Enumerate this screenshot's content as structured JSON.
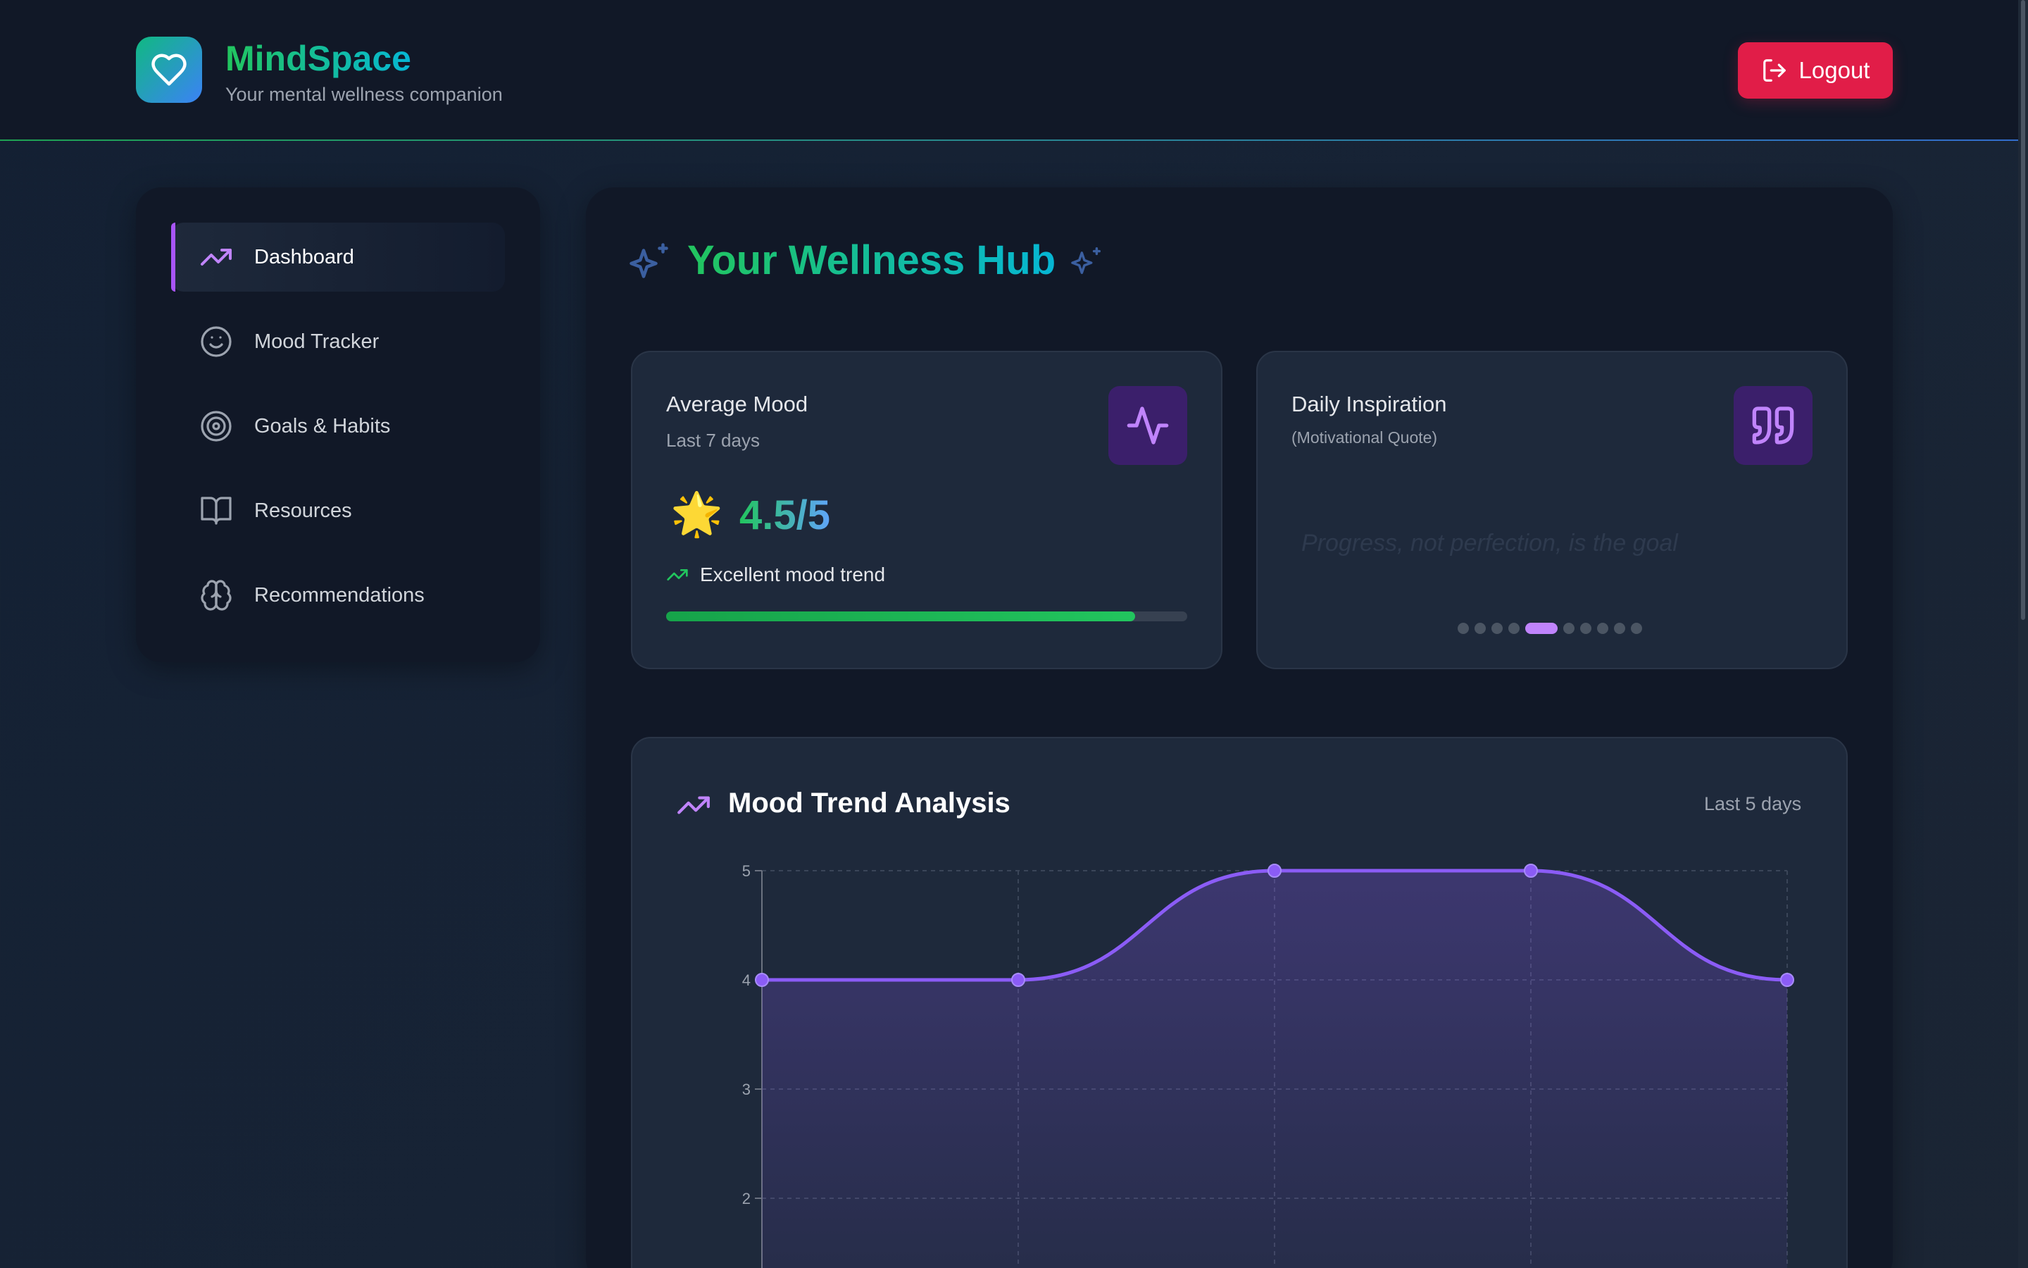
{
  "app": {
    "name": "MindSpace",
    "tagline": "Your mental wellness companion",
    "logout_label": "Logout"
  },
  "sidebar": {
    "items": [
      {
        "label": "Dashboard",
        "icon": "trending-up-icon",
        "active": true
      },
      {
        "label": "Mood Tracker",
        "icon": "smile-icon",
        "active": false
      },
      {
        "label": "Goals & Habits",
        "icon": "target-icon",
        "active": false
      },
      {
        "label": "Resources",
        "icon": "book-open-icon",
        "active": false
      },
      {
        "label": "Recommendations",
        "icon": "brain-icon",
        "active": false
      }
    ]
  },
  "main": {
    "title": "Your Wellness Hub",
    "average_mood": {
      "title": "Average Mood",
      "subtitle": "Last 7 days",
      "emoji": "🌟",
      "value": "4.5/5",
      "trend_label": "Excellent mood trend",
      "progress_fraction": 0.9
    },
    "daily_inspiration": {
      "title": "Daily Inspiration",
      "subtitle": "(Motivational Quote)",
      "quote": "Progress, not perfection, is the goal",
      "dot_count": 10,
      "active_dot": 4
    },
    "mood_trend": {
      "title": "Mood Trend Analysis",
      "range_label": "Last 5 days"
    }
  },
  "colors": {
    "accent_purple": "#a855f7",
    "brand_green": "#22c55e",
    "brand_cyan": "#06b6d4",
    "logout_red": "#e11d48",
    "line_purple": "#8b5cf6"
  },
  "chart_data": {
    "type": "area",
    "title": "Mood Trend Analysis",
    "x": [
      1,
      2,
      3,
      4,
      5
    ],
    "series": [
      {
        "values": [
          4,
          4,
          5,
          5,
          4
        ]
      }
    ],
    "y_ticks": [
      2,
      3,
      4,
      5
    ],
    "ylim": [
      1,
      5
    ],
    "grid": true,
    "curve": "smooth"
  }
}
